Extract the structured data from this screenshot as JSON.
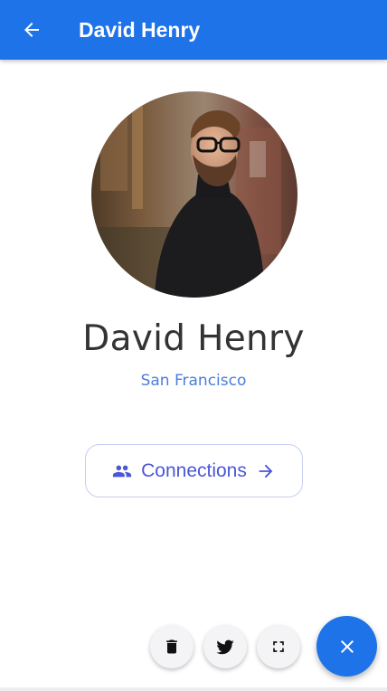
{
  "appbar": {
    "title": "David Henry",
    "back_icon": "arrow-left-icon",
    "color": "#1e73e8"
  },
  "profile": {
    "name": "David Henry",
    "location": "San Francisco"
  },
  "connections_button": {
    "label": "Connections",
    "icon": "people-icon",
    "trailing_icon": "arrow-right-icon"
  },
  "fab_actions": [
    {
      "name": "delete",
      "icon": "trash-icon"
    },
    {
      "name": "twitter",
      "icon": "twitter-icon"
    },
    {
      "name": "fullscreen",
      "icon": "fullscreen-icon"
    }
  ],
  "fab_main": {
    "icon": "close-icon",
    "color": "#1e73e8"
  }
}
